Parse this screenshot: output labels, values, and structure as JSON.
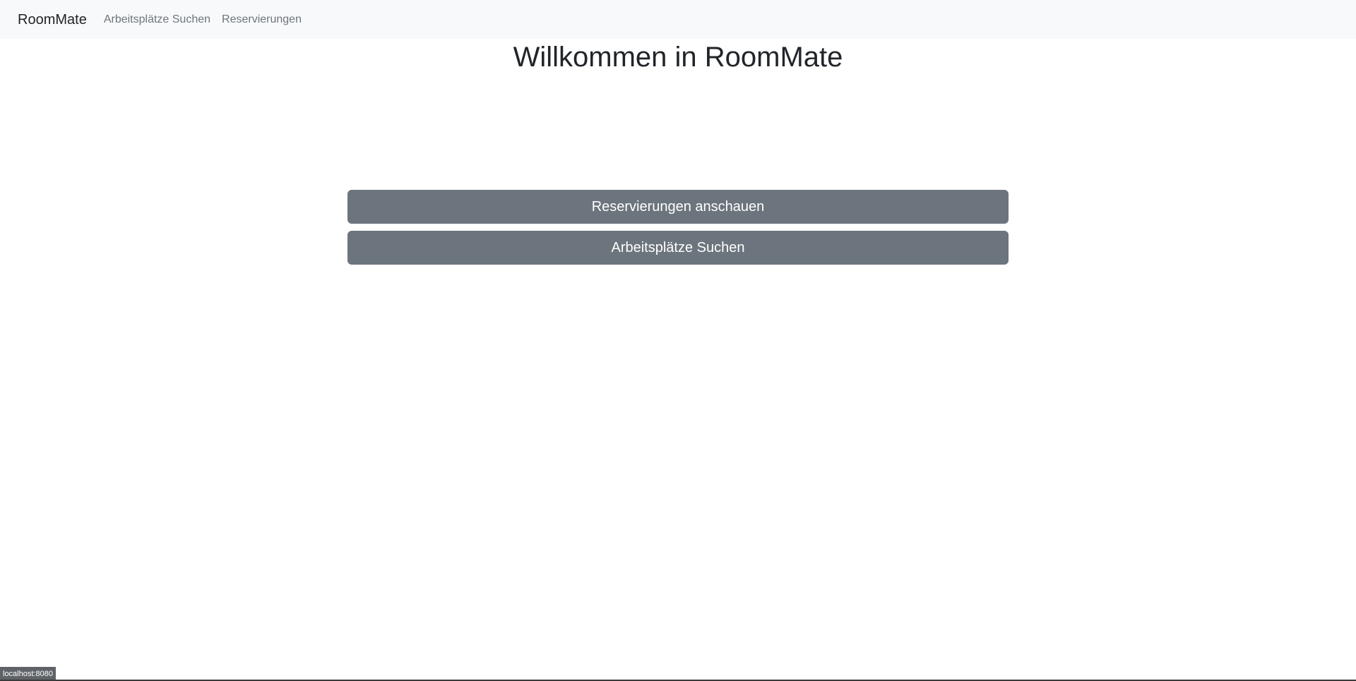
{
  "navbar": {
    "brand": "RoomMate",
    "links": [
      {
        "label": "Arbeitsplätze Suchen"
      },
      {
        "label": "Reservierungen"
      }
    ]
  },
  "main": {
    "title": "Willkommen in RoomMate",
    "buttons": [
      {
        "label": "Reservierungen anschauen"
      },
      {
        "label": "Arbeitsplätze Suchen"
      }
    ],
    "button_color": "#6c757d"
  },
  "status_bar": {
    "url": "localhost:8080"
  }
}
